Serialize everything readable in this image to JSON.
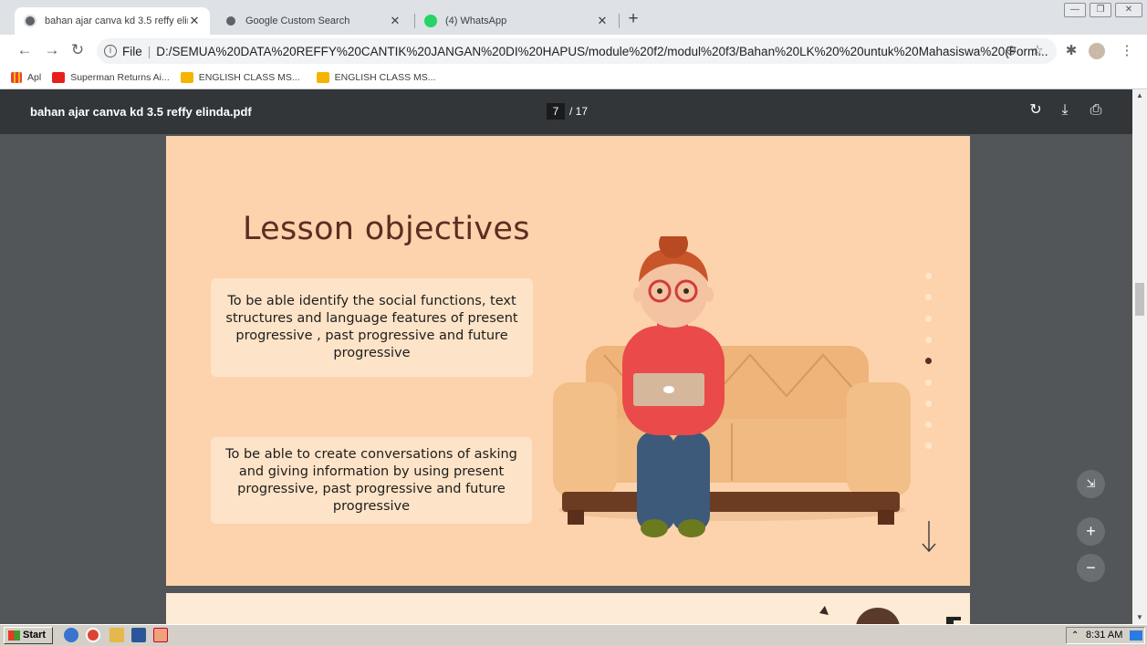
{
  "tabs": [
    {
      "title": "bahan ajar canva kd 3.5 reffy elinda.pdf",
      "active": true
    },
    {
      "title": "Google Custom Search",
      "active": false
    },
    {
      "title": "(4) WhatsApp",
      "active": false
    }
  ],
  "toolbar": {
    "file_label": "File",
    "url": "D:/SEMUA%20DATA%20REFFY%20CANTIK%20JANGAN%20DI%20HAPUS/module%20f2/modul%20f3/Bahan%20LK%20%20untuk%20Mahasiswa%20(Form..."
  },
  "bookmarks": [
    {
      "label": "Apl",
      "icon": "apps-grid-icon"
    },
    {
      "label": "Superman Returns Ai...",
      "icon": "youtube-icon"
    },
    {
      "label": "ENGLISH CLASS MS...",
      "icon": "classroom-icon"
    },
    {
      "label": "ENGLISH CLASS MS...",
      "icon": "classroom-icon"
    }
  ],
  "pdf": {
    "title": "bahan ajar canva kd 3.5 reffy elinda.pdf",
    "current_page": "7",
    "total_pages": "/ 17"
  },
  "slide": {
    "title": "Lesson objectives",
    "objectives": [
      "To be able identify the social functions, text structures and language features of present progressive , past progressive and future progressive",
      "To be able to create conversations of asking and giving information by using present progressive, past progressive and future progressive"
    ],
    "active_dot": 5,
    "dot_count": 9
  },
  "taskbar": {
    "start_label": "Start",
    "clock": "8:31 AM"
  },
  "colors": {
    "slide_bg": "#fdd3ad",
    "title_color": "#5b2e22",
    "pdf_toolbar": "#323639",
    "viewer_bg": "#525659"
  }
}
